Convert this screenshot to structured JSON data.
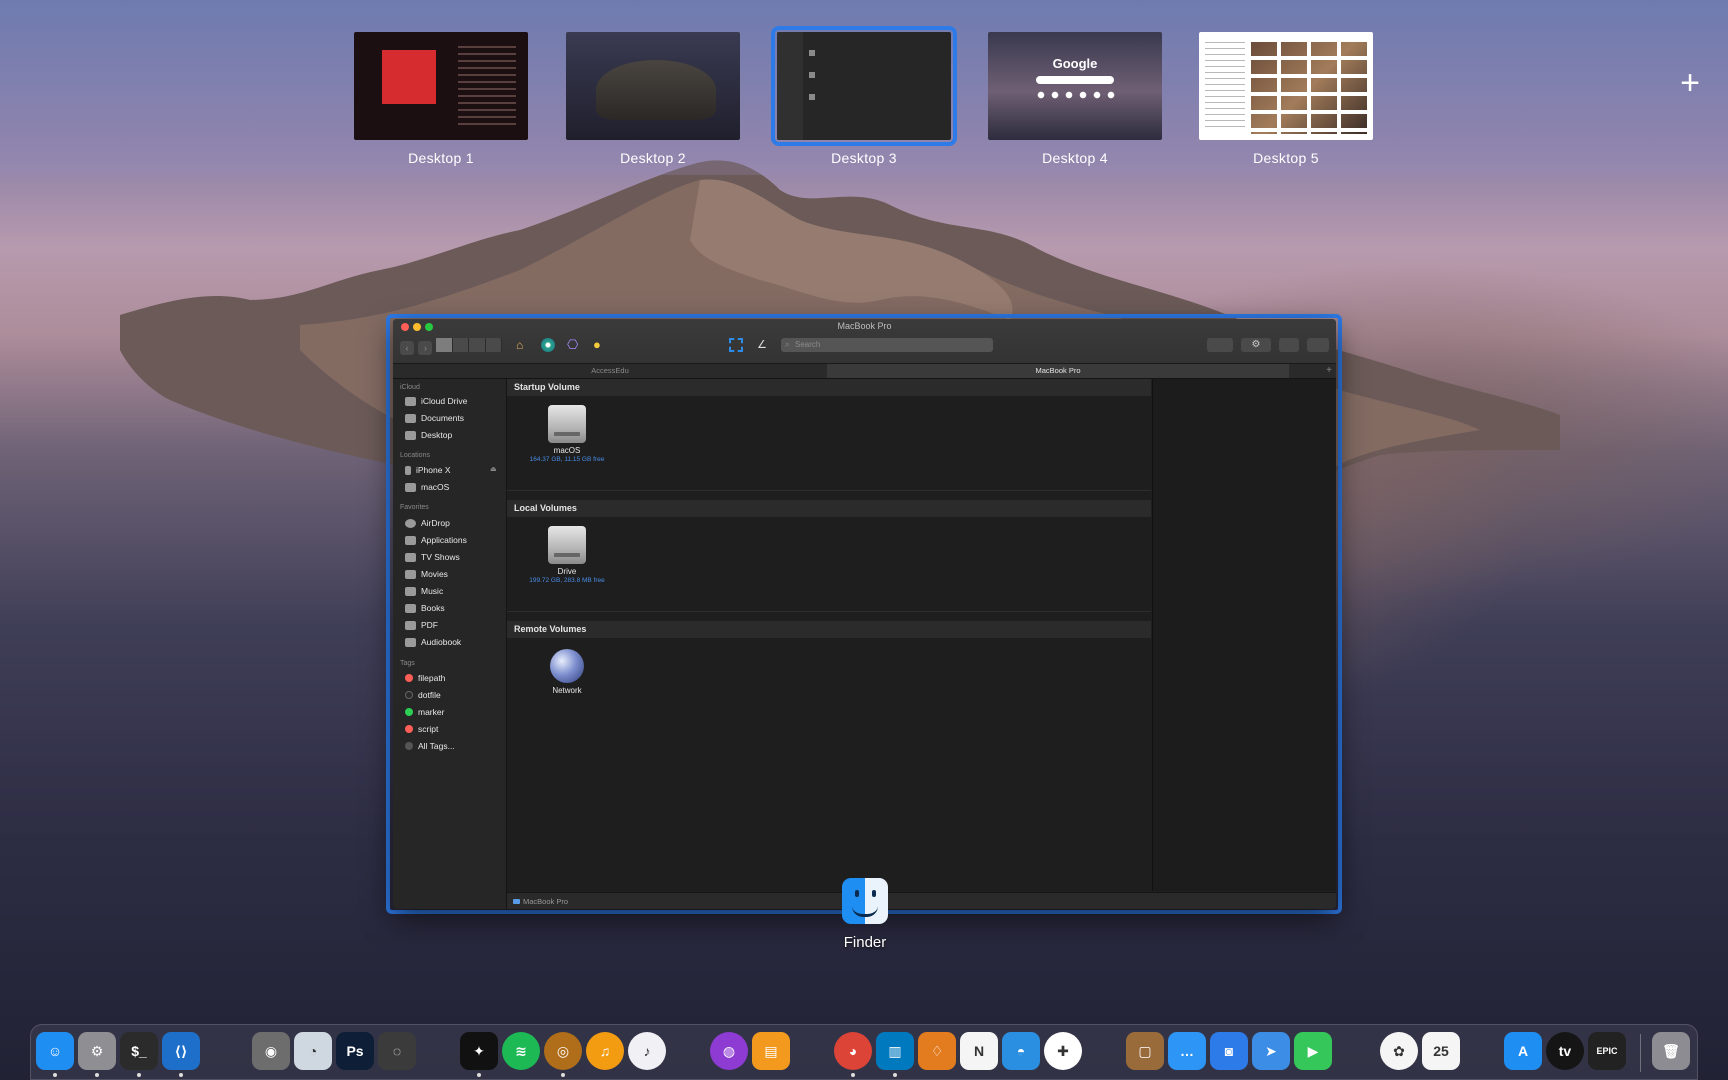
{
  "mission_control": {
    "desktops": [
      {
        "label": "Desktop 1",
        "selected": false
      },
      {
        "label": "Desktop 2",
        "selected": false
      },
      {
        "label": "Desktop 3",
        "selected": true
      },
      {
        "label": "Desktop 4",
        "selected": false
      },
      {
        "label": "Desktop 5",
        "selected": false
      }
    ],
    "desktop4_thumb_text": "Google",
    "add_desktop": "+"
  },
  "finder": {
    "window_title": "MacBook Pro",
    "search_placeholder": "Search",
    "tabs": [
      {
        "label": "AccessEdu",
        "active": false
      },
      {
        "label": "MacBook Pro",
        "active": true
      }
    ],
    "sidebar": {
      "sections": {
        "icloud": "iCloud",
        "locations": "Locations",
        "favorites": "Favorites",
        "tags": "Tags"
      },
      "icloud_items": [
        "iCloud Drive",
        "Documents",
        "Desktop"
      ],
      "location_items": [
        "iPhone X",
        "macOS"
      ],
      "favorite_items": [
        "AirDrop",
        "Applications",
        "TV Shows",
        "Movies",
        "Music",
        "Books",
        "PDF",
        "Audiobook"
      ],
      "tag_items": [
        {
          "label": "filepath",
          "color": "#ff5f57"
        },
        {
          "label": "dotfile",
          "color": "#3a3a3a"
        },
        {
          "label": "marker",
          "color": "#2dcf55"
        },
        {
          "label": "script",
          "color": "#ff5f57"
        },
        {
          "label": "All Tags...",
          "color": "#555555"
        }
      ]
    },
    "groups": [
      {
        "title": "Startup Volume",
        "items": [
          {
            "name": "macOS",
            "detail": "164.37 GB, 11.15 GB free"
          }
        ]
      },
      {
        "title": "Local Volumes",
        "items": [
          {
            "name": "Drive",
            "detail": "199.72 GB, 283.8 MB free"
          }
        ]
      },
      {
        "title": "Remote Volumes",
        "items": [
          {
            "name": "Network",
            "detail": ""
          }
        ]
      }
    ],
    "status_path": "MacBook Pro"
  },
  "app_label": "Finder",
  "dock": {
    "apps": [
      {
        "name": "Finder",
        "icon": "finder-icon",
        "color": "#1f8ef2",
        "glyph": "☺",
        "running": true
      },
      {
        "name": "System Preferences",
        "icon": "gear-icon",
        "color": "#8e8e93",
        "glyph": "⚙",
        "running": true
      },
      {
        "name": "Terminal",
        "icon": "terminal-icon",
        "color": "#2b2b2b",
        "glyph": "$_",
        "running": true
      },
      {
        "name": "Visual Studio Code",
        "icon": "vscode-icon",
        "color": "#1e6fc9",
        "glyph": "⟨⟩",
        "running": true
      },
      {
        "name": "Disk Utility",
        "icon": "disk-utility-icon",
        "color": "#6d6d6d",
        "glyph": "◉",
        "running": false
      },
      {
        "name": "Disk Diag",
        "icon": "pie-chart-icon",
        "color": "#cfd8e0",
        "glyph": "◔",
        "running": false
      },
      {
        "name": "Photoshop",
        "icon": "photoshop-icon",
        "color": "#0d1e36",
        "glyph": "Ps",
        "running": false
      },
      {
        "name": "iStat",
        "icon": "gauge-icon",
        "color": "#3b3b3b",
        "glyph": "◌",
        "running": false
      },
      {
        "name": "Tidal",
        "icon": "tidal-icon",
        "color": "#111111",
        "glyph": "✦",
        "running": true
      },
      {
        "name": "Spotify",
        "icon": "spotify-icon",
        "color": "#1db954",
        "glyph": "≋",
        "running": false
      },
      {
        "name": "Speaker",
        "icon": "speaker-icon",
        "color": "#b06d1a",
        "glyph": "◎",
        "running": true
      },
      {
        "name": "Audio App",
        "icon": "audio-icon",
        "color": "#f39c12",
        "glyph": "♫",
        "running": false
      },
      {
        "name": "Music",
        "icon": "music-icon",
        "color": "#f0f0f5",
        "glyph": "♪",
        "running": false
      },
      {
        "name": "Podcasts",
        "icon": "podcasts-icon",
        "color": "#8e3bd4",
        "glyph": "◍",
        "running": false
      },
      {
        "name": "Books",
        "icon": "books-icon",
        "color": "#f39a1e",
        "glyph": "▤",
        "running": false
      },
      {
        "name": "Chrome",
        "icon": "chrome-icon",
        "color": "#db4437",
        "glyph": "◕",
        "running": true
      },
      {
        "name": "Trello",
        "icon": "trello-icon",
        "color": "#0079bf",
        "glyph": "▥",
        "running": true
      },
      {
        "name": "Sourcetree",
        "icon": "sourcetree-icon",
        "color": "#e37b1f",
        "glyph": "♢",
        "running": false
      },
      {
        "name": "News",
        "icon": "news-icon",
        "color": "#f5f5f5",
        "glyph": "N",
        "running": false
      },
      {
        "name": "Tweetbot",
        "icon": "tweetbot-icon",
        "color": "#2a8fe0",
        "glyph": "◓",
        "running": false
      },
      {
        "name": "Slack",
        "icon": "slack-icon",
        "color": "#ffffff",
        "glyph": "✚",
        "running": false
      },
      {
        "name": "Notefile",
        "icon": "notebook-icon",
        "color": "#9a6b3a",
        "glyph": "▢",
        "running": false
      },
      {
        "name": "Messages",
        "icon": "messages-icon",
        "color": "#2d95f5",
        "glyph": "…",
        "running": false
      },
      {
        "name": "Messenger",
        "icon": "chat-icon",
        "color": "#2d7be9",
        "glyph": "◙",
        "running": false
      },
      {
        "name": "Spark",
        "icon": "spark-icon",
        "color": "#3b8de6",
        "glyph": "➤",
        "running": false
      },
      {
        "name": "FaceTime",
        "icon": "facetime-icon",
        "color": "#35c759",
        "glyph": "▶",
        "running": false
      },
      {
        "name": "Photos",
        "icon": "photos-icon",
        "color": "#f5f5f5",
        "glyph": "✿",
        "running": false
      },
      {
        "name": "Calendar",
        "icon": "calendar-icon",
        "color": "#f5f5f5",
        "glyph": "25",
        "running": false
      },
      {
        "name": "App Store",
        "icon": "appstore-icon",
        "color": "#1f8ef2",
        "glyph": "A",
        "running": false
      },
      {
        "name": "TV",
        "icon": "tv-icon",
        "color": "#151515",
        "glyph": "tv",
        "running": false
      },
      {
        "name": "Epic Games",
        "icon": "epic-games-icon",
        "color": "#222222",
        "glyph": "EPIC",
        "running": false
      },
      {
        "name": "Trash",
        "icon": "trash-icon",
        "color": "#8c8c92",
        "glyph": "🗑",
        "running": false
      }
    ]
  }
}
